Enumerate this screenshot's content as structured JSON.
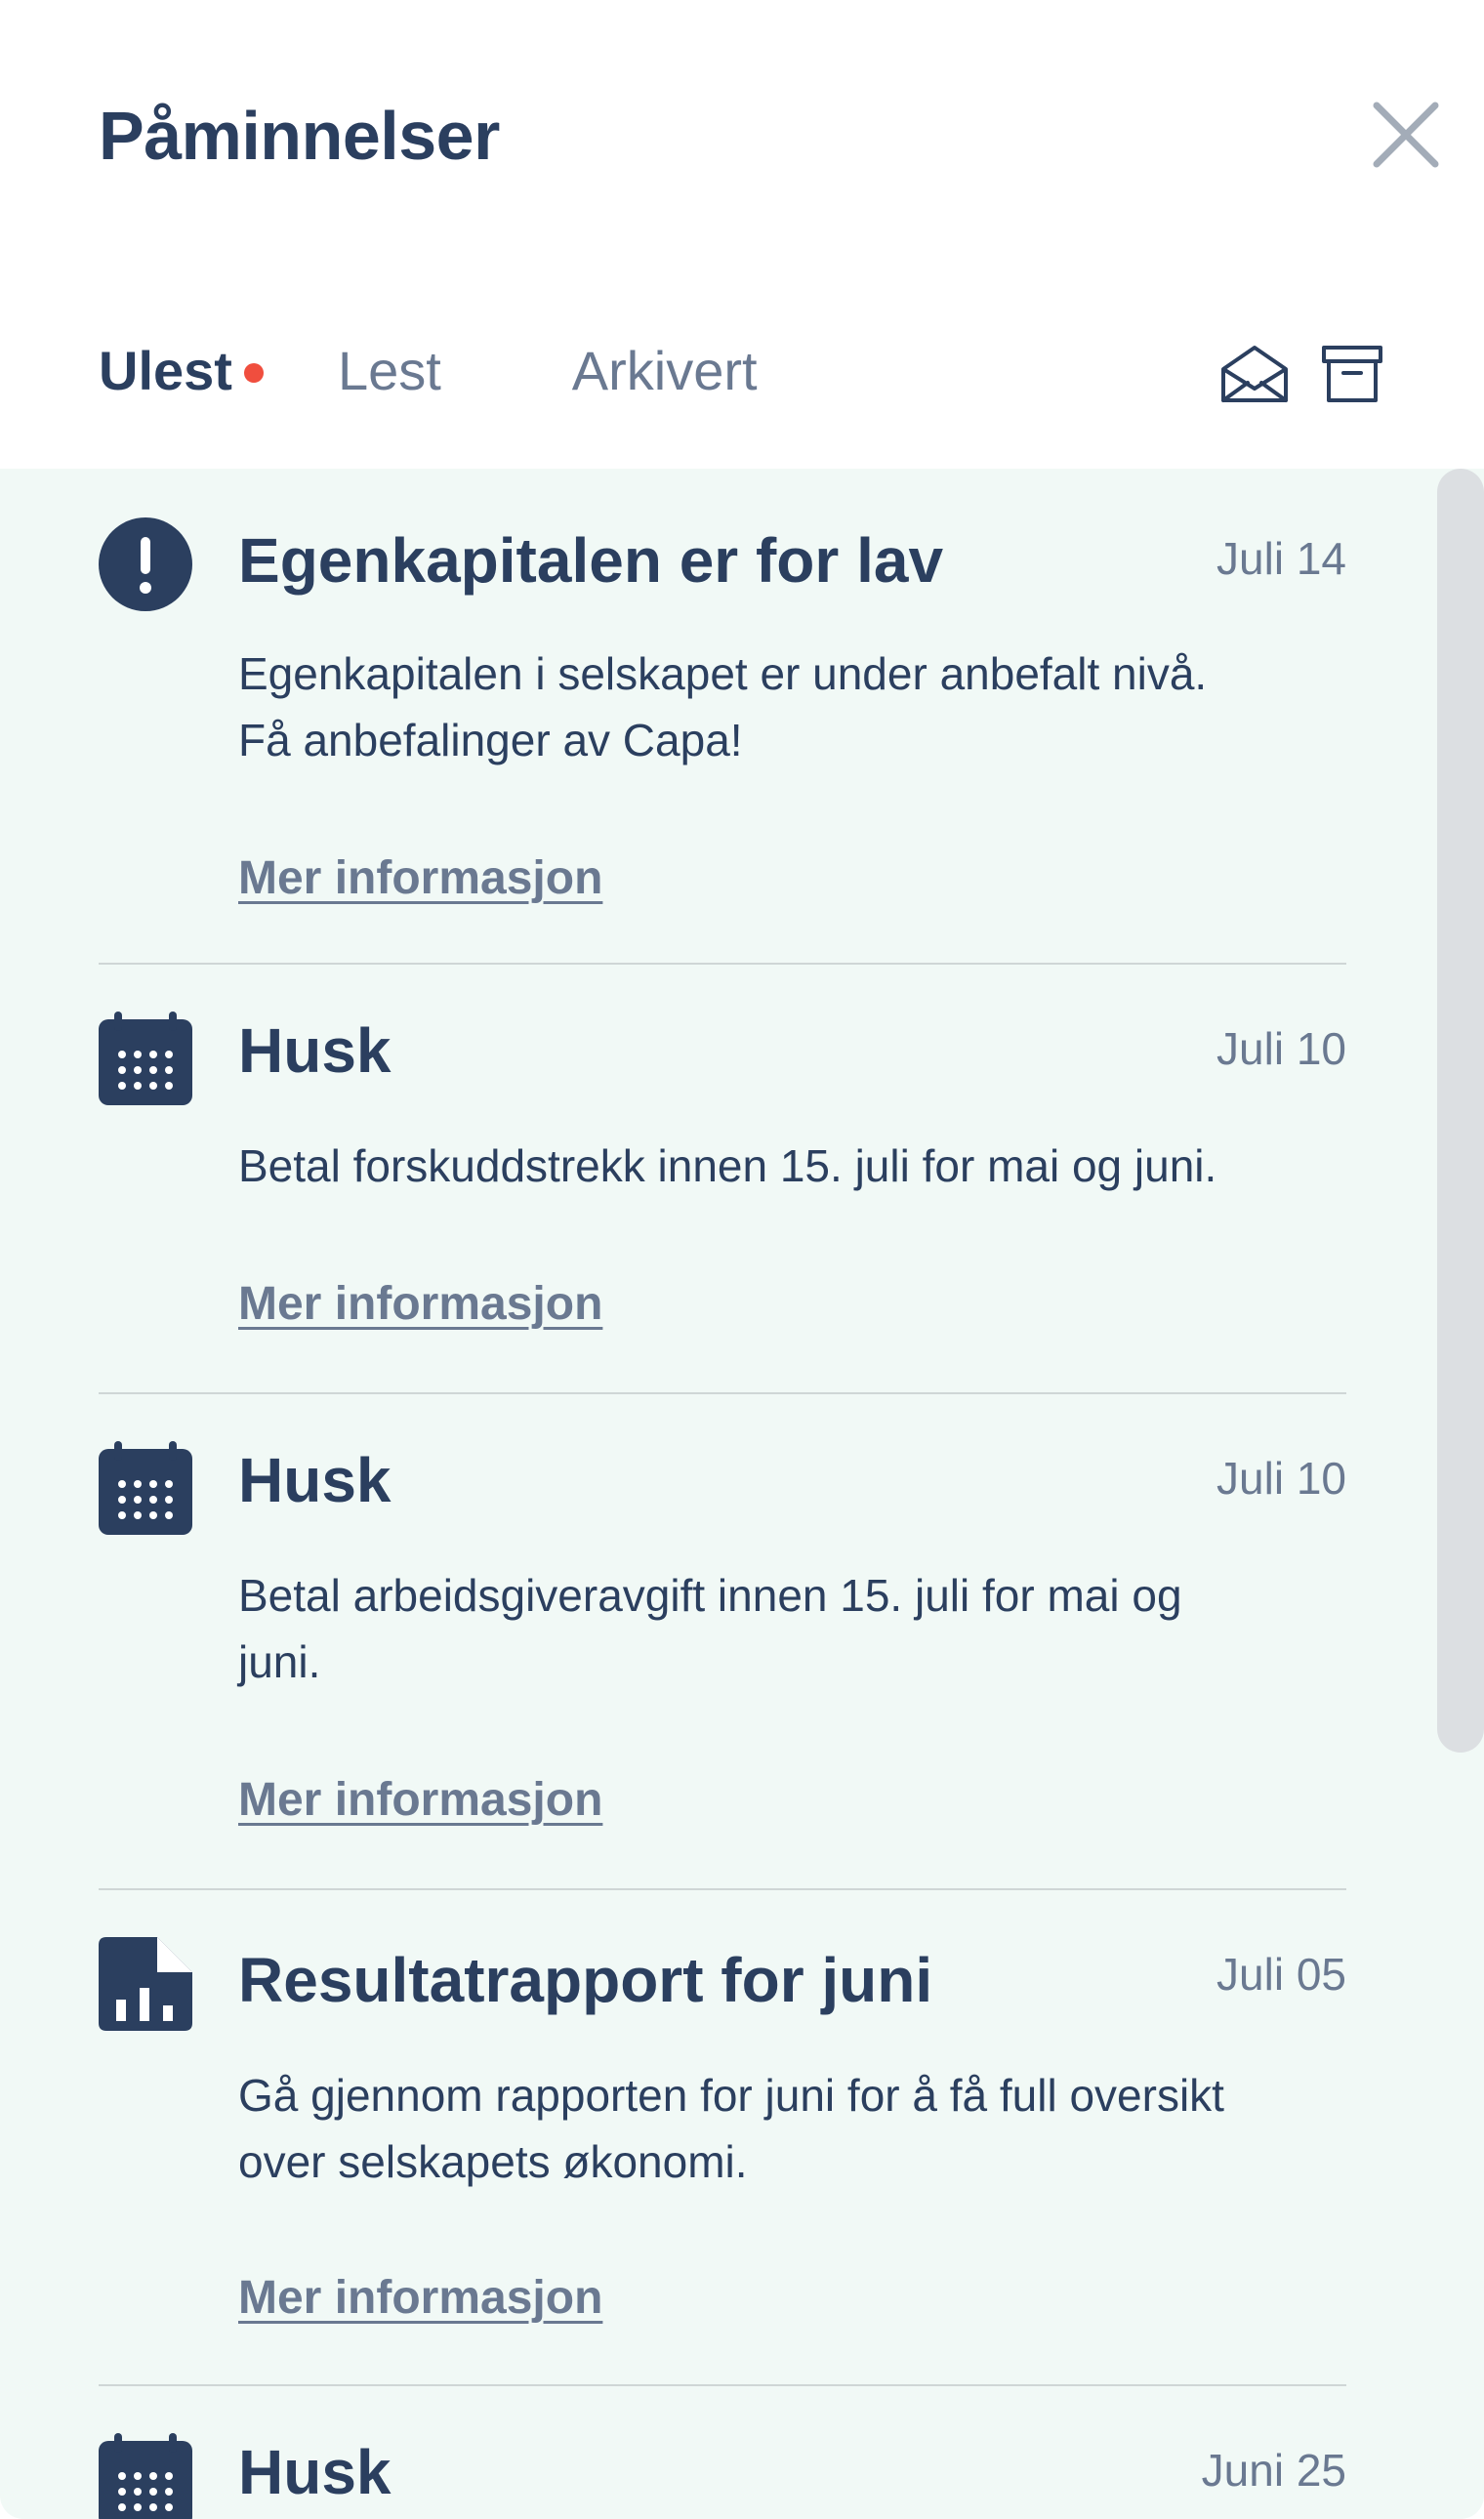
{
  "header": {
    "title": "Påminnelser",
    "close_icon": "close-icon"
  },
  "tabs": [
    {
      "label": "Ulest",
      "active": true,
      "has_unread_dot": true
    },
    {
      "label": "Lest",
      "active": false
    },
    {
      "label": "Arkivert",
      "active": false
    }
  ],
  "actions": {
    "mark_read_icon": "envelope-open-icon",
    "archive_icon": "archive-box-icon"
  },
  "notifications": [
    {
      "icon": "exclamation-circle-icon",
      "title": "Egenkapitalen er for lav",
      "date": "Juli 14",
      "body_lines": [
        "Egenkapitalen i selskapet er under anbefalt nivå.",
        "Få anbefalinger av Capa!"
      ],
      "link": "Mer informasjon"
    },
    {
      "icon": "calendar-icon",
      "title": "Husk",
      "date": "Juli 10",
      "body_lines": [
        "Betal forskuddstrekk innen 15. juli for mai og juni."
      ],
      "link": "Mer informasjon"
    },
    {
      "icon": "calendar-icon",
      "title": "Husk",
      "date": "Juli 10",
      "body_lines": [
        "Betal arbeidsgiveravgift innen 15. juli for mai og",
        "juni."
      ],
      "link": "Mer informasjon"
    },
    {
      "icon": "report-chart-icon",
      "title": "Resultatrapport for juni",
      "date": "Juli 05",
      "body_lines": [
        "Gå gjennom rapporten for juni for å få full oversikt",
        "over selskapets økonomi."
      ],
      "link": "Mer informasjon"
    },
    {
      "icon": "calendar-icon",
      "title": "Husk",
      "date": "Juni 25"
    }
  ],
  "colors": {
    "primary": "#2b3f5f",
    "muted": "#6a7991",
    "unread_dot": "#f04e3e",
    "list_background": "#f1f9f6"
  }
}
